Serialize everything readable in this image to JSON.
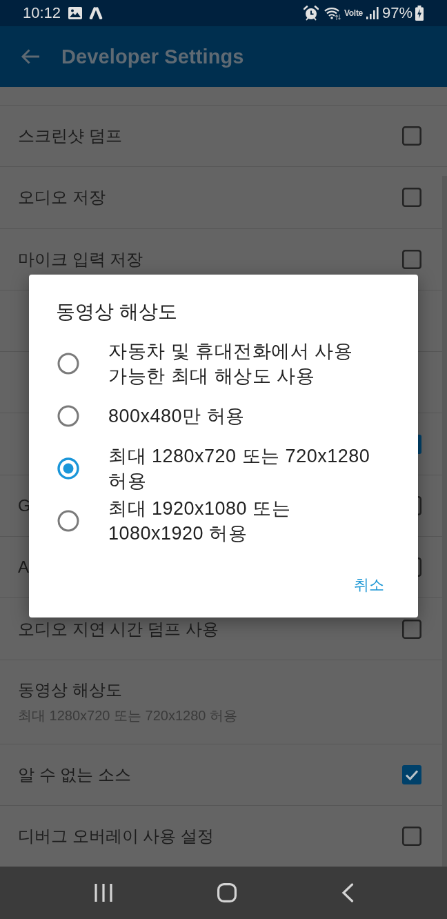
{
  "status_bar": {
    "time": "10:12",
    "network_label": "Volte",
    "battery": "97%"
  },
  "app_bar": {
    "title": "Developer Settings"
  },
  "settings": [
    {
      "kind": "checkbox",
      "label": "스크린샷 덤프",
      "checked": false
    },
    {
      "kind": "checkbox",
      "label": "오디오 저장",
      "checked": false
    },
    {
      "kind": "checkbox",
      "label": "마이크 입력 저장",
      "checked": false
    },
    {
      "kind": "plain"
    },
    {
      "kind": "plain"
    },
    {
      "kind": "checkbox",
      "checked": true
    },
    {
      "kind": "checkbox",
      "label": "G",
      "checked": false
    },
    {
      "kind": "checkbox",
      "label": "A",
      "checked": false
    },
    {
      "kind": "checkbox",
      "label": "오디오 지연 시간 덤프 사용",
      "checked": false
    },
    {
      "kind": "summary",
      "label": "동영상 해상도",
      "summary": "최대 1280x720 또는 720x1280 허용"
    },
    {
      "kind": "checkbox",
      "label": "알 수 없는 소스",
      "checked": true
    },
    {
      "kind": "checkbox",
      "label": "디버그 오버레이 사용 설정",
      "checked": false
    }
  ],
  "dialog": {
    "title": "동영상 해상도",
    "options": [
      {
        "label": "자동차 및 휴대전화에서 사용 가능한 최대 해상도 사용",
        "selected": false
      },
      {
        "label": "800x480만 허용",
        "selected": false
      },
      {
        "label": "최대 1280x720 또는 720x1280 허용",
        "selected": true
      },
      {
        "label": "최대 1920x1080 또는 1080x1920 허용",
        "selected": false
      }
    ],
    "buttons": [
      "취소"
    ]
  }
}
